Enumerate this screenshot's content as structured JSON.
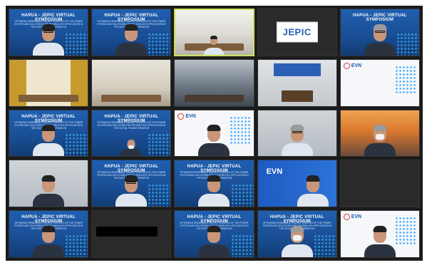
{
  "banner": {
    "title": "HAPUA - JEPIC VIRTUAL SYMPOSIUM",
    "subtitle": "OPTIMIZING RENEWABLE ENERGY SOURCES OF THE POWER SYSTEM AND SOLUTIONS FOR TECHNOLOGY APPLICATION IN THE DIGITAL TRANSFORMATION"
  },
  "logos": {
    "jepic": "JEPIC",
    "evn": "EVN"
  },
  "colors": {
    "frame": "#1b1b1b",
    "active_border": "#c9e25a",
    "banner_blue": "#1f5fb0",
    "evn_red": "#e3342f"
  }
}
